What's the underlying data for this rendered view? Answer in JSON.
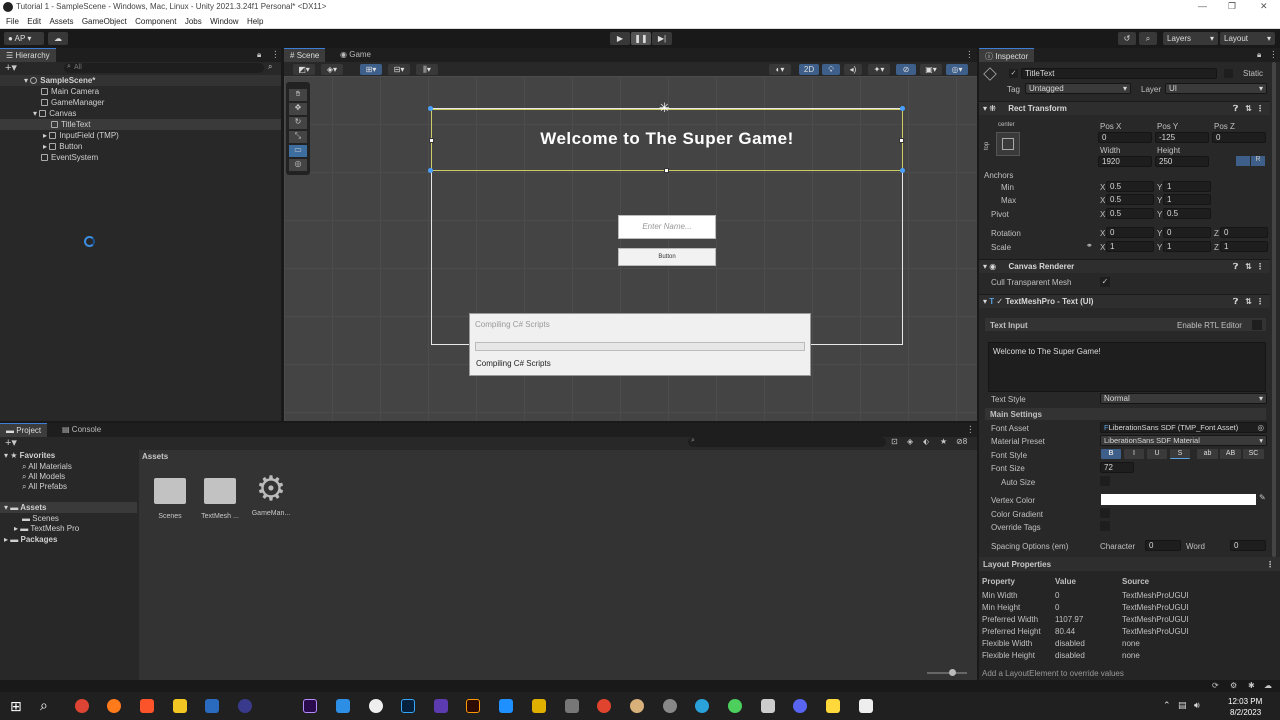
{
  "window": {
    "title": "Tutorial 1 - SampleScene - Windows, Mac, Linux - Unity 2021.3.24f1 Personal* <DX11>"
  },
  "menu": [
    "File",
    "Edit",
    "Assets",
    "GameObject",
    "Component",
    "Jobs",
    "Window",
    "Help"
  ],
  "toolbar": {
    "account": "AP",
    "layers": "Layers",
    "layout": "Layout"
  },
  "hierarchy": {
    "tab": "Hierarchy",
    "search_placeholder": "All",
    "items": [
      {
        "label": "SampleScene*",
        "indent": 0
      },
      {
        "label": "Main Camera",
        "indent": 1
      },
      {
        "label": "GameManager",
        "indent": 1
      },
      {
        "label": "Canvas",
        "indent": 1
      },
      {
        "label": "TitleText",
        "indent": 2
      },
      {
        "label": "InputField (TMP)",
        "indent": 2
      },
      {
        "label": "Button",
        "indent": 2
      },
      {
        "label": "EventSystem",
        "indent": 1
      }
    ]
  },
  "scene": {
    "tabs": [
      "Scene",
      "Game"
    ],
    "mode2d": "2D",
    "title_text": "Welcome to The Super Game!",
    "input_placeholder": "Enter Name...",
    "button_label": "Button"
  },
  "dialog": {
    "title": "Compiling C# Scripts",
    "message": "Compiling C# Scripts"
  },
  "project": {
    "tabs": [
      "Project",
      "Console"
    ],
    "favorites_label": "Favorites",
    "favorites": [
      "All Materials",
      "All Models",
      "All Prefabs"
    ],
    "assets_label": "Assets",
    "assets_children": [
      "Scenes",
      "TextMesh Pro"
    ],
    "packages_label": "Packages",
    "breadcrumb": "Assets",
    "tiles": [
      "Scenes",
      "TextMesh ...",
      "GameMan..."
    ]
  },
  "inspector": {
    "tab": "Inspector",
    "object_name": "TitleText",
    "static_label": "Static",
    "tag_label": "Tag",
    "tag_value": "Untagged",
    "layer_label": "Layer",
    "layer_value": "UI",
    "rect_transform": {
      "header": "Rect Transform",
      "anchor_h": "center",
      "anchor_v": "top",
      "pos_x_label": "Pos X",
      "pos_x": "0",
      "pos_y_label": "Pos Y",
      "pos_y": "-125",
      "pos_z_label": "Pos Z",
      "pos_z": "0",
      "width_label": "Width",
      "width": "1920",
      "height_label": "Height",
      "height": "250",
      "anchors_label": "Anchors",
      "min_label": "Min",
      "min_x": "0.5",
      "min_y": "1",
      "max_label": "Max",
      "max_x": "0.5",
      "max_y": "1",
      "pivot_label": "Pivot",
      "pivot_x": "0.5",
      "pivot_y": "0.5",
      "rotation_label": "Rotation",
      "rot_x": "0",
      "rot_y": "0",
      "rot_z": "0",
      "scale_label": "Scale",
      "scale_x": "1",
      "scale_y": "1",
      "scale_z": "1"
    },
    "canvas_renderer": {
      "header": "Canvas Renderer",
      "cull_label": "Cull Transparent Mesh"
    },
    "tmp": {
      "header": "TextMeshPro - Text (UI)",
      "text_input_label": "Text Input",
      "rtl_label": "Enable RTL Editor",
      "text_value": "Welcome to The Super Game!",
      "text_style_label": "Text Style",
      "text_style": "Normal",
      "main_settings": "Main Settings",
      "font_asset_label": "Font Asset",
      "font_asset": "LiberationSans SDF (TMP_Font Asset)",
      "material_label": "Material Preset",
      "material": "LiberationSans SDF Material",
      "font_style_label": "Font Style",
      "font_styles": [
        "B",
        "I",
        "U",
        "S",
        "ab",
        "AB",
        "SC"
      ],
      "font_size_label": "Font Size",
      "font_size": "72",
      "auto_size_label": "Auto Size",
      "vertex_color_label": "Vertex Color",
      "color_gradient_label": "Color Gradient",
      "override_tags_label": "Override Tags",
      "spacing_label": "Spacing Options (em)",
      "character_label": "Character",
      "character": "0",
      "word_label": "Word",
      "word": "0"
    }
  },
  "layout_props": {
    "header": "Layout Properties",
    "columns": [
      "Property",
      "Value",
      "Source"
    ],
    "rows": [
      [
        "Min Width",
        "0",
        "TextMeshProUGUI"
      ],
      [
        "Min Height",
        "0",
        "TextMeshProUGUI"
      ],
      [
        "Preferred Width",
        "1107.97",
        "TextMeshProUGUI"
      ],
      [
        "Preferred Height",
        "80.44",
        "TextMeshProUGUI"
      ],
      [
        "Flexible Width",
        "disabled",
        "none"
      ],
      [
        "Flexible Height",
        "disabled",
        "none"
      ]
    ],
    "footer": "Add a LayoutElement to override values"
  },
  "taskbar": {
    "time": "12:03 PM",
    "date": "8/2/2023"
  },
  "colors": {
    "accent": "#3c7fd9",
    "selection": "#3a3a3a",
    "gizmo": "#cccc66"
  }
}
